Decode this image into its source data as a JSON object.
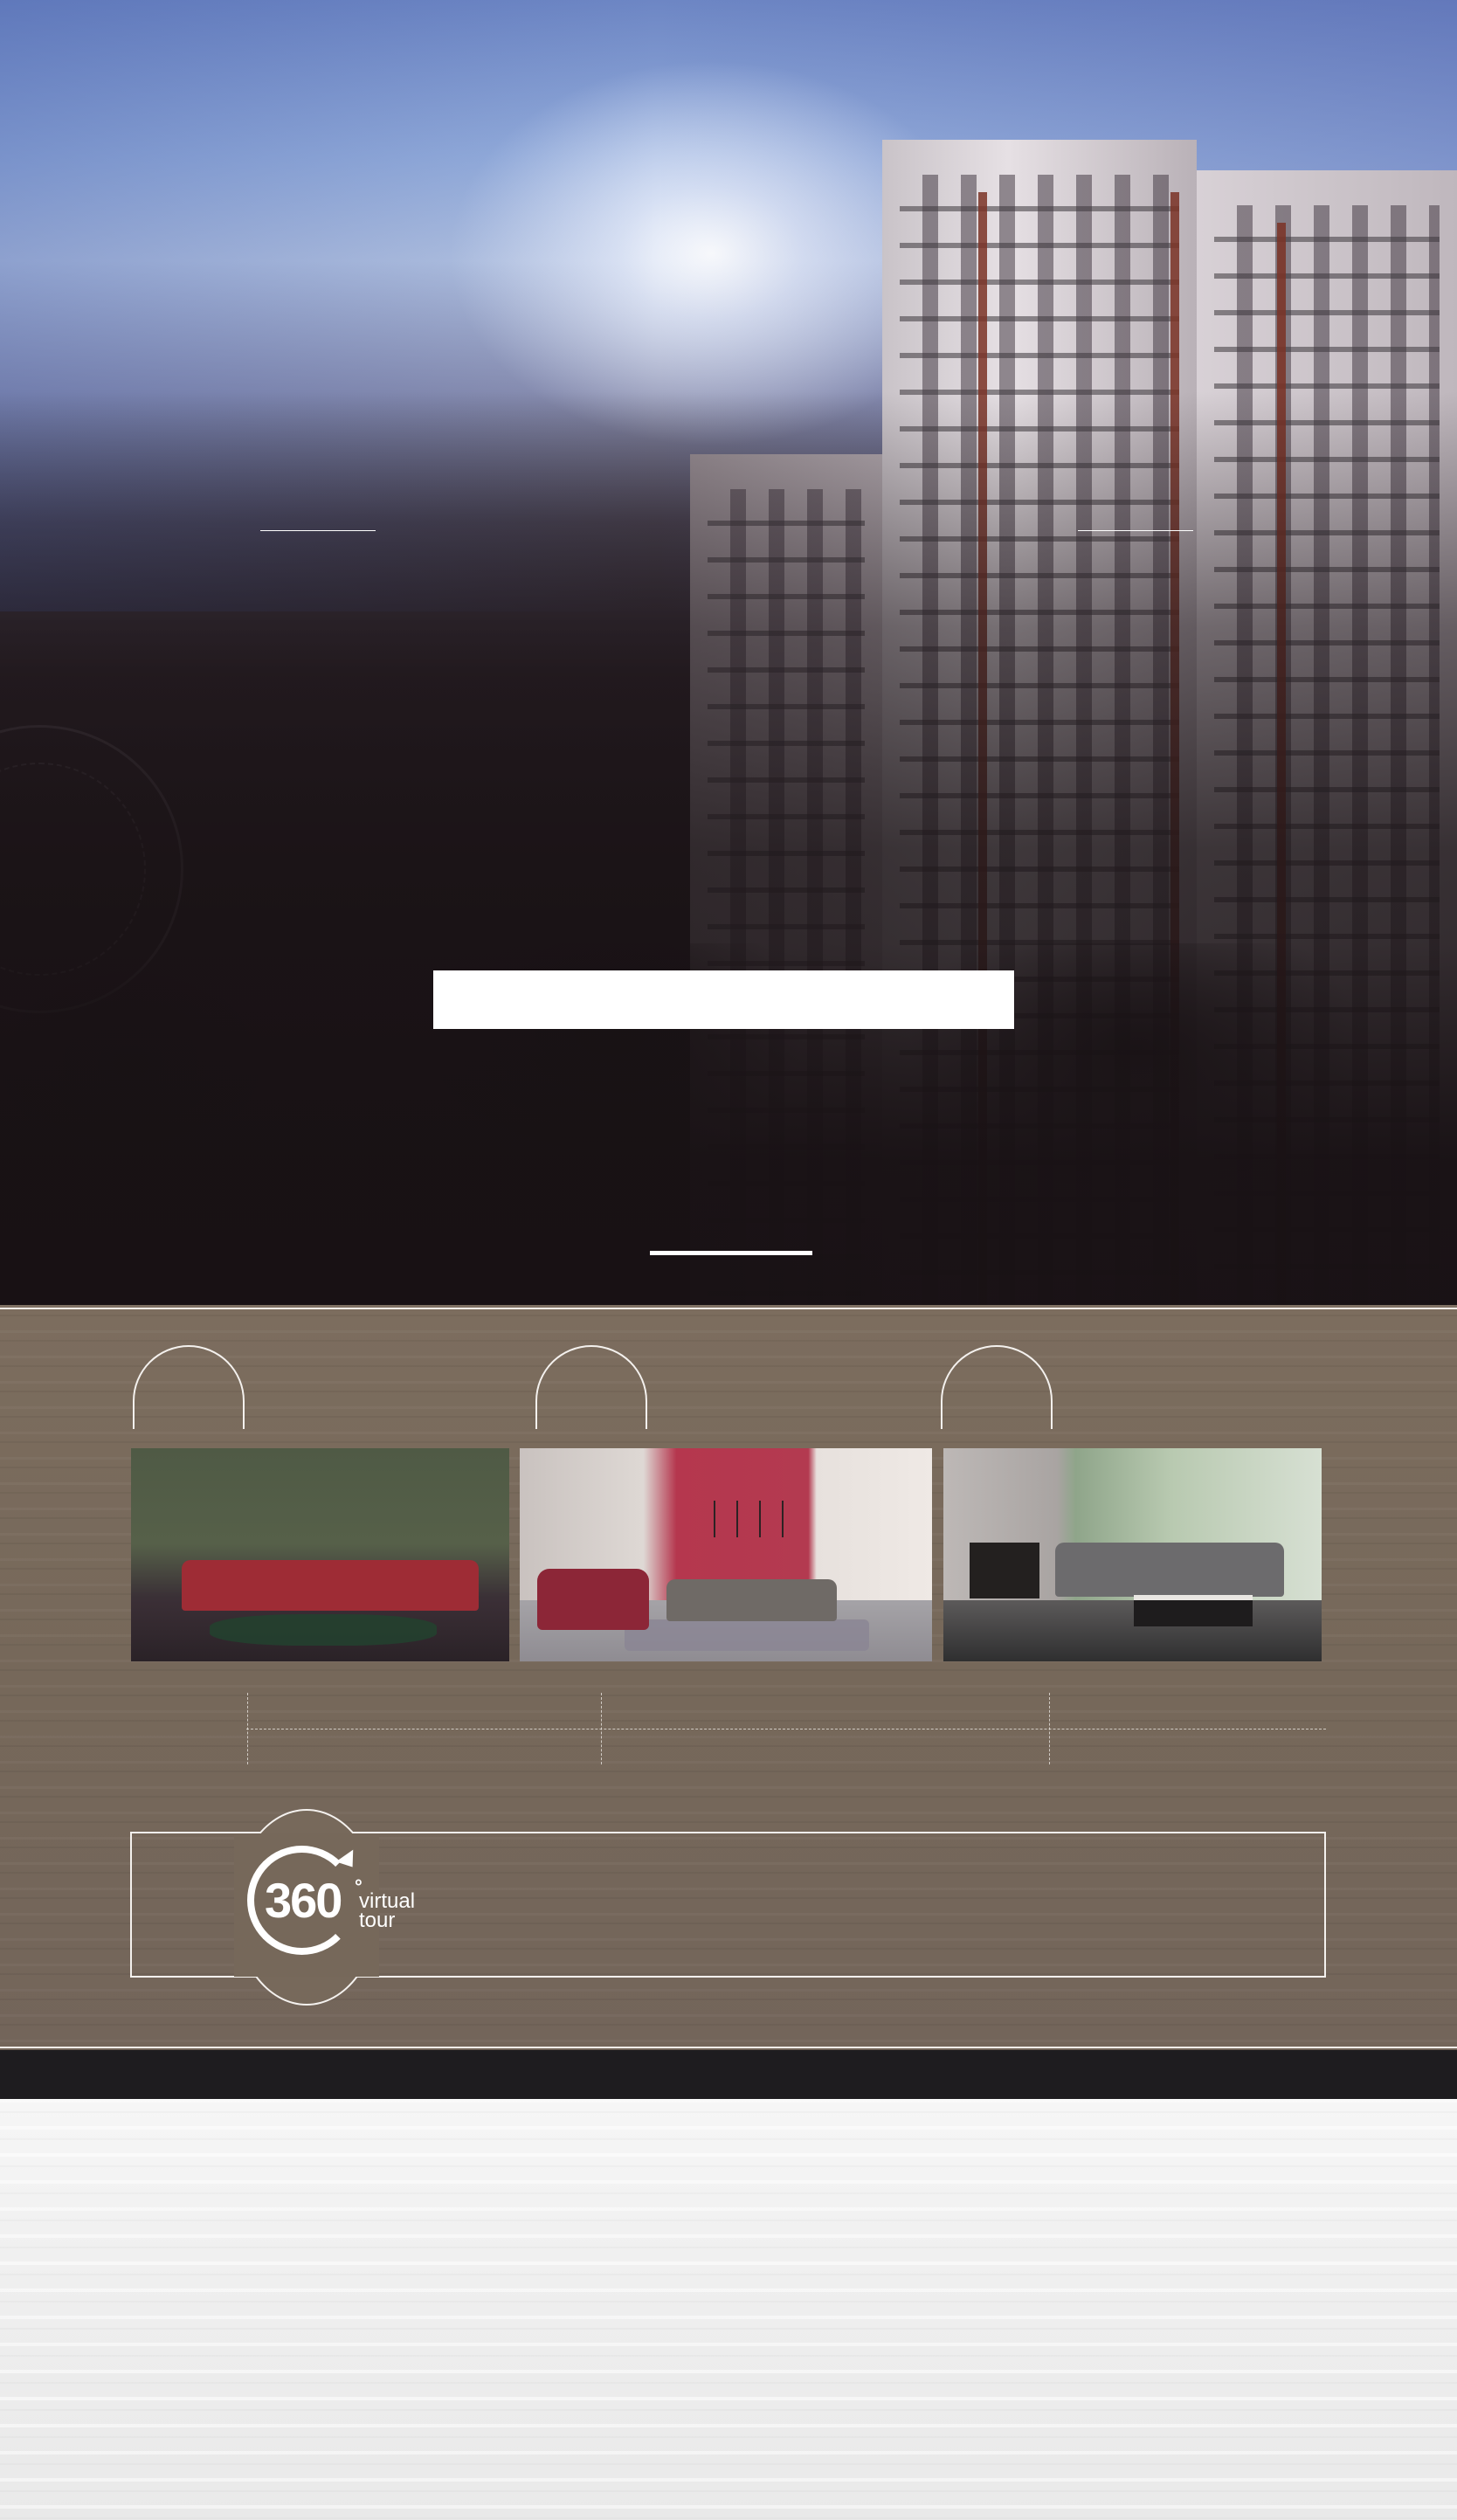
{
  "hero": {
    "cta_label": "",
    "tower_accent_color": "#7a3326"
  },
  "showcase": {
    "photos": [
      {
        "icon": "living-room-photo",
        "sofa_color": "#9e2c35"
      },
      {
        "icon": "living-room-photo",
        "sofa_color": "#6f6a66"
      },
      {
        "icon": "living-room-photo",
        "sofa_color": "#6c6b6d"
      }
    ]
  },
  "virtual_tour": {
    "number": "360",
    "degree": "°",
    "word1": "virtual",
    "word2": "tour"
  },
  "colors": {
    "wood": "#76685a",
    "dark_band": "#1e1c1f",
    "line": "#f4f1ee"
  }
}
